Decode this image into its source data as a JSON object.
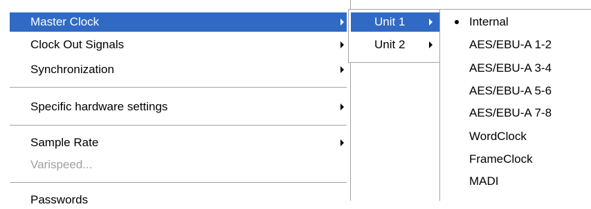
{
  "main_menu": {
    "items": [
      {
        "label": "Master Clock",
        "mnemonic": "k",
        "has_submenu": true,
        "highlighted": true
      },
      {
        "label": "Clock Out Signals",
        "mnemonic": "O",
        "has_submenu": true
      },
      {
        "label": "Synchronization",
        "mnemonic": "S",
        "has_submenu": true
      },
      {
        "label": "Specific hardware settings",
        "has_submenu": true
      },
      {
        "label": "Sample Rate",
        "mnemonic": "S",
        "has_submenu": true
      },
      {
        "label": "Varispeed...",
        "mnemonic": "V",
        "disabled": true
      },
      {
        "label": "Passwords"
      }
    ]
  },
  "unit_menu": {
    "items": [
      {
        "label": "Unit 1",
        "highlighted": true,
        "has_submenu": true
      },
      {
        "label": "Unit 2",
        "has_submenu": true
      }
    ]
  },
  "clock_menu": {
    "selected": "Internal",
    "items": [
      {
        "label": "Internal"
      },
      {
        "label": "AES/EBU-A 1-2"
      },
      {
        "label": "AES/EBU-A 3-4"
      },
      {
        "label": "AES/EBU-A 5-6"
      },
      {
        "label": "AES/EBU-A 7-8"
      },
      {
        "label": "WordClock"
      },
      {
        "label": "FrameClock"
      },
      {
        "label": "MADI"
      }
    ]
  },
  "colors": {
    "highlight_bg": "#316ac5",
    "highlight_text": "#ffffff",
    "disabled_text": "#a0a0a0",
    "separator": "#a0a0a0"
  }
}
